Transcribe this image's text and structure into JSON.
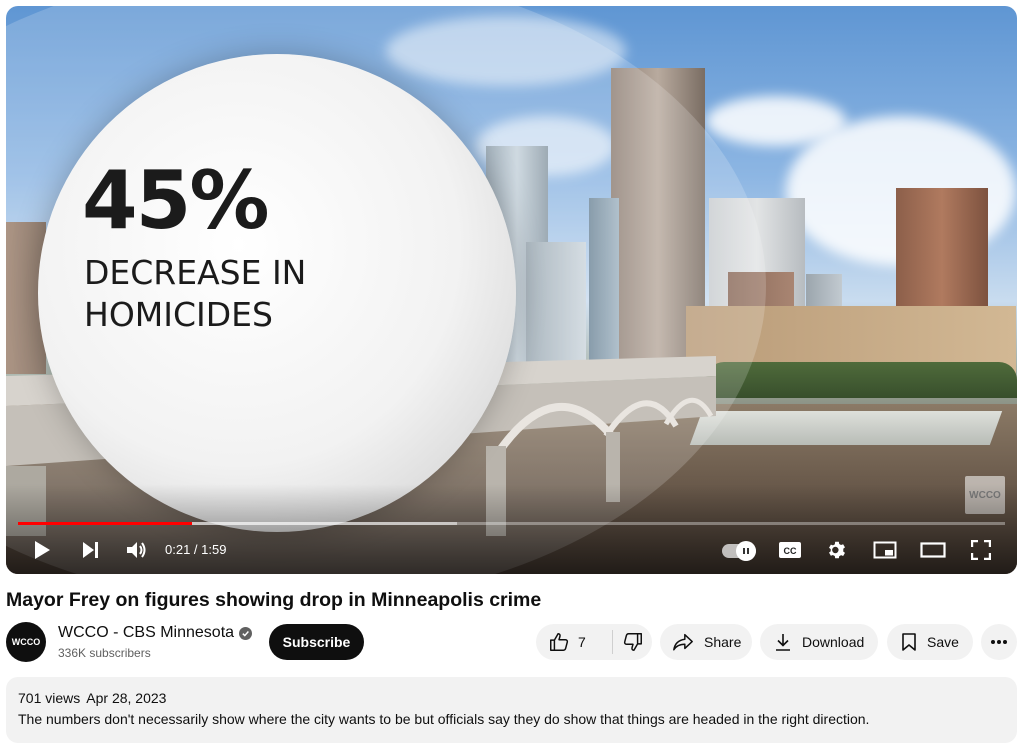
{
  "video": {
    "overlay_stat": "45%",
    "overlay_label": "DECREASE IN HOMICIDES",
    "watermark": "WCCO",
    "time_current": "0:21",
    "time_total": "1:59",
    "time_display": "0:21 / 1:59",
    "progress_played_fraction": 0.176,
    "progress_loaded_fraction": 0.445,
    "controls": {
      "play": "play-icon",
      "next": "next-icon",
      "volume": "volume-icon",
      "autoplay": "autoplay-toggle",
      "captions": "CC",
      "settings": "gear-icon",
      "miniplayer": "miniplayer-icon",
      "theater": "theater-icon",
      "fullscreen": "fullscreen-icon"
    }
  },
  "title": "Mayor Frey on figures showing drop in Minneapolis crime",
  "channel": {
    "avatar_text": "WCCO",
    "name": "WCCO - CBS Minnesota",
    "subscribers": "336K subscribers",
    "subscribe_label": "Subscribe"
  },
  "actions": {
    "like_count": "7",
    "share_label": "Share",
    "download_label": "Download",
    "save_label": "Save"
  },
  "description": {
    "views": "701 views",
    "date": "Apr 28, 2023",
    "text": "The numbers don't necessarily show where the city wants to be but officials say they do show that things are headed in the right direction."
  },
  "colors": {
    "progress": "#ff0000",
    "pill_bg": "#f2f2f2",
    "text": "#0f0f0f",
    "secondary_text": "#606060"
  }
}
